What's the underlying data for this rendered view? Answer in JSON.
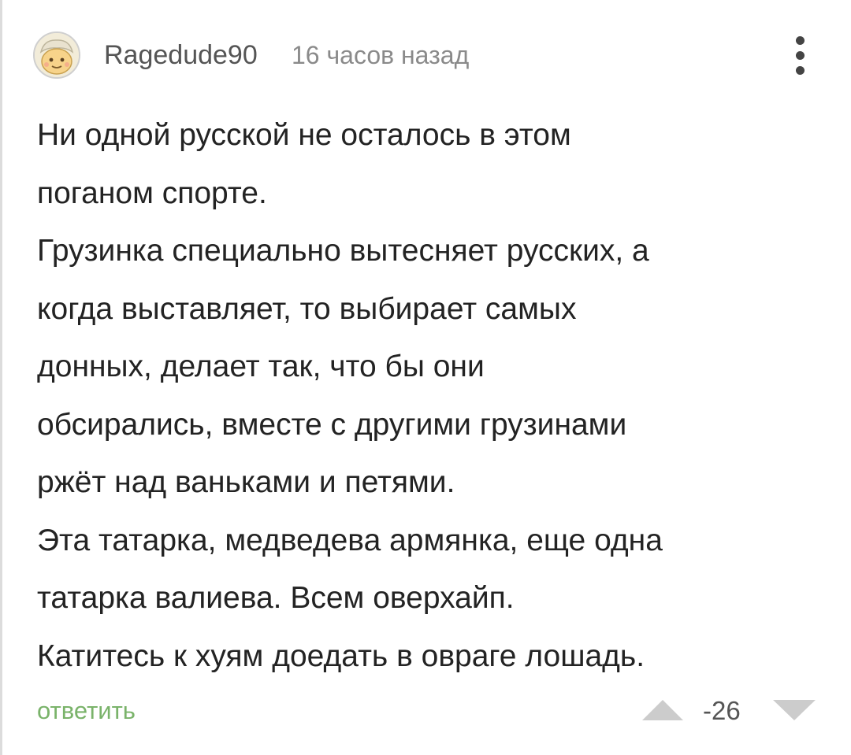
{
  "comment": {
    "author": {
      "username": "Ragedude90",
      "avatar_icon": "cartoon-face-avatar"
    },
    "timestamp": "16 часов назад",
    "more_icon": "vertical-ellipsis-icon",
    "body_lines": [
      "Ни одной русской не осталось в этом",
      "поганом спорте.",
      "Грузинка специально вытесняет русских, а",
      "когда выставляет, то выбирает самых",
      "донных, делает так, что бы они",
      "обсирались, вместе с другими грузинами",
      "ржёт над ваньками и петями.",
      "Эта татарка, медведева армянка, еще одна",
      "татарка валиева. Всем оверхайп.",
      "Катитесь к хуям доедать в овраге лошадь."
    ],
    "actions": {
      "reply_label": "ответить",
      "rating": "-26",
      "upvote_icon": "triangle-up-icon",
      "downvote_icon": "triangle-down-icon"
    }
  },
  "colors": {
    "reply": "#7ab36a",
    "text": "#232323",
    "muted": "#8a8a8a",
    "vote_arrow": "#cccccc"
  }
}
